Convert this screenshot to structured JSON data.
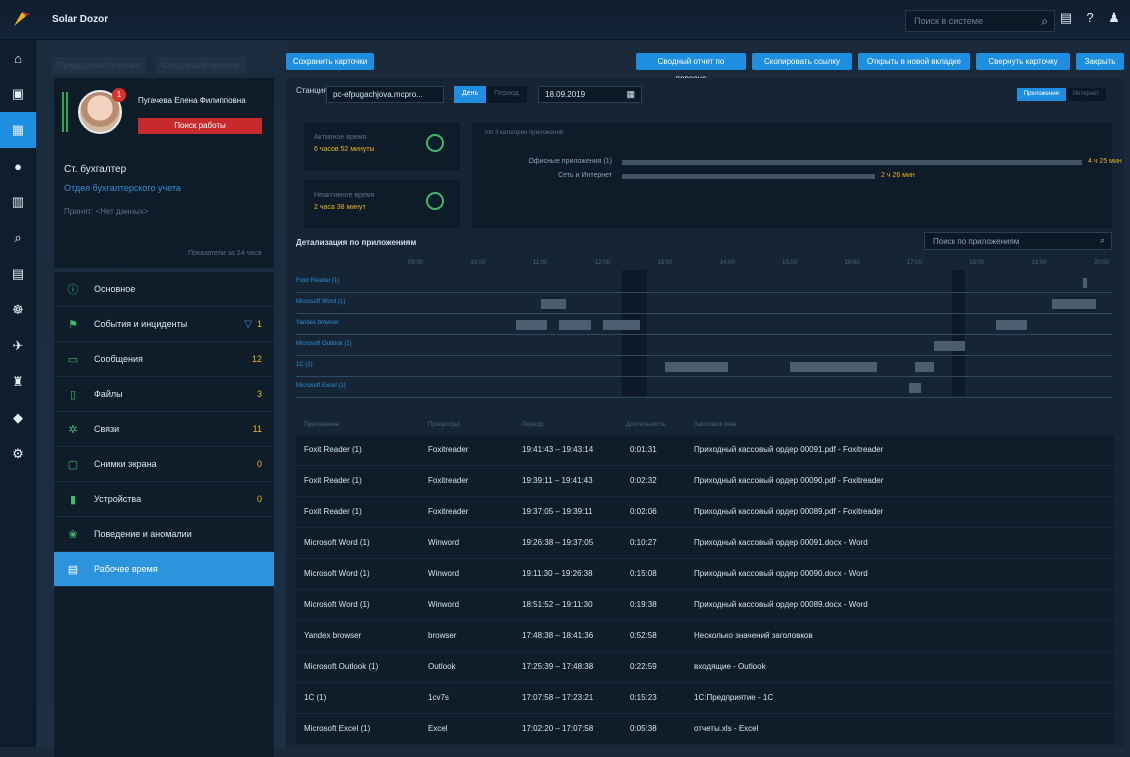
{
  "app": {
    "title": "Solar Dozor"
  },
  "header": {
    "search_placeholder": "Поиск в системе"
  },
  "breadcrumbs": [
    "Предыдущий персоне",
    "Следующий персоне"
  ],
  "profile": {
    "name": "Пугачева Елена Филипповна",
    "badge": "1",
    "job_button": "Поиск работы",
    "role": "Ст. бухгалтер",
    "department": "Отдел бухгалтерского учета",
    "accepted": "Принят: <Нет данных>"
  },
  "period_note": "Показатели за 24 часа",
  "menu": [
    {
      "label": "Основное",
      "count": ""
    },
    {
      "label": "События и инциденты",
      "count": "1"
    },
    {
      "label": "Сообщения",
      "count": "12"
    },
    {
      "label": "Файлы",
      "count": "3"
    },
    {
      "label": "Связи",
      "count": "11"
    },
    {
      "label": "Снимки экрана",
      "count": "0"
    },
    {
      "label": "Устройства",
      "count": "0"
    },
    {
      "label": "Поведение и аномалии",
      "count": ""
    },
    {
      "label": "Рабочее время",
      "count": ""
    }
  ],
  "actions": {
    "save_cards": "Сохранить карточки",
    "summary_report": "Сводный отчет по персоне",
    "copy_link": "Скопировать ссылку",
    "open_new_tab": "Открыть в новой вкладке",
    "collapse_card": "Свернуть карточку",
    "close": "Закрыть"
  },
  "station": {
    "label": "Станция",
    "value": "pc-efpugachjova.mcpro..."
  },
  "mode": {
    "day": "День",
    "period": "Период"
  },
  "date": "18.09.2019",
  "view": {
    "apps": "Приложения",
    "internet": "Интернет"
  },
  "active_time": {
    "label": "Активное время",
    "value": "6 часов 52 минуты"
  },
  "inactive_time": {
    "label": "Неактивное время",
    "value": "2 часа 38 минут"
  },
  "top_categories": {
    "title": "топ 3 категории приложений",
    "items": [
      {
        "label": "Офисные приложения (1)",
        "value": "4 ч 25 мин",
        "share": 1.0
      },
      {
        "label": "Сеть и Интернет",
        "value": "2 ч 26 мин",
        "share": 0.55
      }
    ]
  },
  "details": {
    "title": "Детализация по приложениям",
    "search_placeholder": "Поиск по приложениям"
  },
  "timeline": {
    "hours": [
      "09:00",
      "10:00",
      "11:00",
      "12:00",
      "13:00",
      "14:00",
      "15:00",
      "16:00",
      "17:00",
      "18:00",
      "19:00",
      "20:00"
    ],
    "rows": [
      {
        "label": "Foxit Reader (1)",
        "segments": [
          [
            19.7,
            19.75
          ]
        ]
      },
      {
        "label": "Microsoft Word (1)",
        "segments": [
          [
            11.0,
            11.4
          ],
          [
            19.2,
            19.9
          ]
        ]
      },
      {
        "label": "Yandex browser",
        "segments": [
          [
            10.6,
            11.1
          ],
          [
            11.3,
            11.8
          ],
          [
            12.0,
            12.6
          ],
          [
            18.3,
            18.8
          ]
        ]
      },
      {
        "label": "Microsoft Outlook (1)",
        "segments": [
          [
            17.3,
            17.8
          ]
        ]
      },
      {
        "label": "1C (1)",
        "segments": [
          [
            13.0,
            14.0
          ],
          [
            15.0,
            16.4
          ],
          [
            17.0,
            17.3
          ]
        ]
      },
      {
        "label": "Microsoft Excel (1)",
        "segments": [
          [
            16.9,
            17.1
          ]
        ]
      }
    ]
  },
  "table": {
    "headers": [
      "Приложение",
      "Процесс(ы)",
      "Период",
      "Длительность",
      "Заголовок окна"
    ],
    "rows": [
      [
        "Foxit Reader (1)",
        "Foxitreader",
        "19:41:43 – 19:43:14",
        "0:01:31",
        "Приходный кассовый ордер 00091.pdf - Foxitreader"
      ],
      [
        "Foxit Reader (1)",
        "Foxitreader",
        "19:39:11 – 19:41:43",
        "0:02:32",
        "Приходный кассовый ордер 00090.pdf - Foxitreader"
      ],
      [
        "Foxit Reader (1)",
        "Foxitreader",
        "19:37:05 – 19:39:11",
        "0:02:06",
        "Приходный кассовый ордер 00089.pdf - Foxitreader"
      ],
      [
        "Microsoft Word (1)",
        "Winword",
        "19:26:38 – 19:37:05",
        "0:10:27",
        "Приходный кассовый ордер 00091.docx - Word"
      ],
      [
        "Microsoft Word (1)",
        "Winword",
        "19:11:30 – 19:26:38",
        "0:15:08",
        "Приходный кассовый ордер 00090.docx - Word"
      ],
      [
        "Microsoft Word (1)",
        "Winword",
        "18:51:52 – 19:11:30",
        "0:19:38",
        "Приходный кассовый ордер 00089.docx - Word"
      ],
      [
        "Yandex browser",
        "browser",
        "17:48:38 – 18:41:36",
        "0:52:58",
        "Несколько значений заголовков"
      ],
      [
        "Microsoft Outlook (1)",
        "Outlook",
        "17:25:39 – 17:48:38",
        "0:22:59",
        "входящие - Outlook"
      ],
      [
        "1C (1)",
        "1cv7s",
        "17:07:58 – 17:23:21",
        "0:15:23",
        "1С:Предприятие - 1С"
      ],
      [
        "Microsoft Excel (1)",
        "Excel",
        "17:02:20 – 17:07:58",
        "0:05:38",
        "отчеты.xls - Excel"
      ]
    ]
  },
  "colors": {
    "accent": "#1e8ee0",
    "warning": "#e8b321",
    "danger": "#c62a2d",
    "ok": "#3dba6b"
  }
}
